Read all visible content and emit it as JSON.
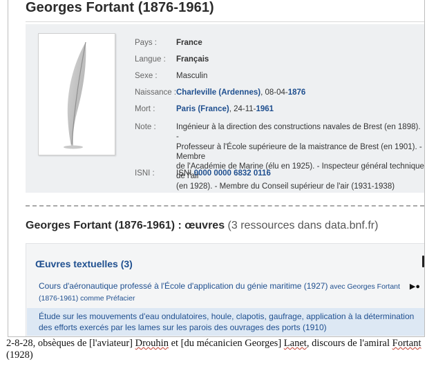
{
  "page": {
    "title": "Georges Fortant (1876-1961)",
    "fields": {
      "pays": {
        "label": "Pays :",
        "value": "France"
      },
      "langue": {
        "label": "Langue :",
        "value": "Français"
      },
      "sexe": {
        "label": "Sexe :",
        "value": "Masculin"
      },
      "naissance": {
        "label": "Naissance :",
        "place": "Charleville (Ardennes)",
        "sep": ", 08-04-",
        "year": "1876"
      },
      "mort": {
        "label": "Mort :",
        "place": "Paris (France)",
        "sep": ", 24-11-",
        "year": "1961"
      },
      "note": {
        "label": "Note :",
        "value": "Ingénieur à la direction des constructions navales de Brest (en 1898). -\nProfesseur à l'École supérieure de la maistrance de Brest (en 1901). - Membre\nde l'Académie de Marine (élu en 1925). - Inspecteur général technique de l'air\n(en 1928). - Membre du Conseil supérieur de l'air (1931-1938)"
      },
      "isni": {
        "label": "ISNI :",
        "prefix": "ISNI ",
        "value": "0000 0000 6832 0116"
      }
    },
    "works": {
      "heading_bold": "Georges Fortant (1876-1961) : œuvres",
      "heading_count": " (3 ressources dans data.bnf.fr)",
      "panel_title": "Œuvres textuelles (3)",
      "item1_title": "Cours d'aéronautique professé à l'École d'application du génie maritime (1927)",
      "item1_role": " avec Georges Fortant (1876-1961) comme Préfacier",
      "item2_title": "Étude sur les mouvements d'eau ondulatoires, houle, clapotis, gaufrage, application à la détermination des efforts exercés par les lames sur les parois des ouvrages des ports (1910)"
    }
  },
  "caption": {
    "p1": "2-8-28, obsèques de [l'aviateur] ",
    "w1": "Drouhin",
    "p2": " et [du mécanicien  Georges] ",
    "w2": "Lanet",
    "p3": ", discours de l'amiral ",
    "w3": "Fortant",
    "p4": " (1928)"
  },
  "colors": {
    "link": "#1f4f8f",
    "card_bg": "#eef0f2",
    "highlight": "#dde8f4"
  },
  "icons": {
    "placeholder": "quill-icon",
    "play": "play-circle-icon"
  }
}
